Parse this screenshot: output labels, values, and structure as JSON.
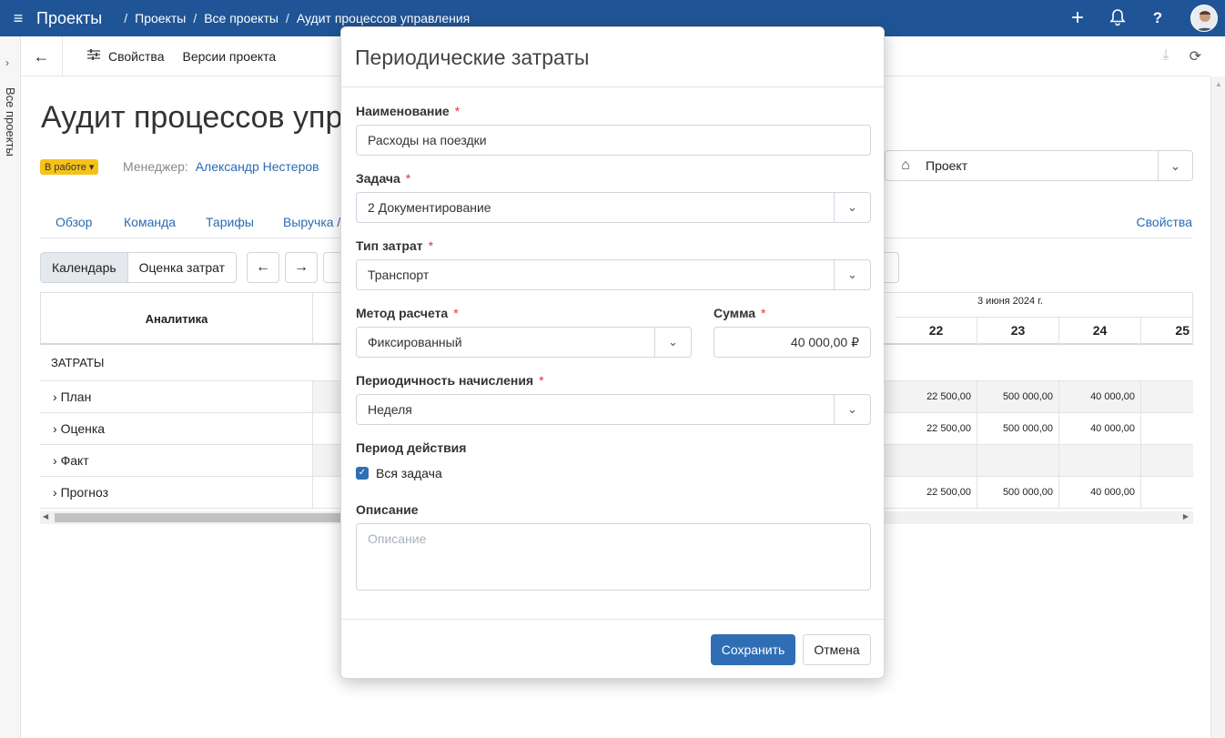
{
  "topbar": {
    "app_title": "Проекты",
    "breadcrumb": [
      "Проекты",
      "Все проекты",
      "Аудит процессов управления"
    ],
    "icons": [
      "plus-icon",
      "bell-icon",
      "help-icon"
    ]
  },
  "rail": {
    "label": "Все проекты"
  },
  "toolbar": {
    "properties": "Свойства",
    "versions": "Версии проекта"
  },
  "project": {
    "title": "Аудит процессов упра",
    "status": "В работе",
    "manager_label": "Менеджер:",
    "manager_name": "Александр Нестеров",
    "selector": "Проект"
  },
  "tabs": [
    "Обзор",
    "Команда",
    "Тарифы",
    "Выручка /"
  ],
  "tabs_right": "Свойства",
  "view": {
    "calendar": "Календарь",
    "estimate": "Оценка затрат"
  },
  "table": {
    "header": "Аналитика",
    "month": "3 июня 2024 г.",
    "days": [
      "22",
      "23",
      "24",
      "25"
    ],
    "section": "ЗАТРАТЫ",
    "rows": [
      {
        "label": "План",
        "values": [
          "22 500,00",
          "500 000,00",
          "40 000,00"
        ]
      },
      {
        "label": "Оценка",
        "values": [
          "22 500,00",
          "500 000,00",
          "40 000,00"
        ]
      },
      {
        "label": "Факт",
        "values": [
          "",
          "",
          ""
        ]
      },
      {
        "label": "Прогноз",
        "values": [
          "22 500,00",
          "500 000,00",
          "40 000,00"
        ]
      }
    ]
  },
  "modal": {
    "title": "Периодические затраты",
    "name_label": "Наименование",
    "name_value": "Расходы на поездки",
    "task_label": "Задача",
    "task_value": "2 Документирование",
    "cost_type_label": "Тип затрат",
    "cost_type_value": "Транспорт",
    "method_label": "Метод расчета",
    "method_value": "Фиксированный",
    "sum_label": "Сумма",
    "sum_value": "40 000,00 ₽",
    "period_label": "Периодичность начисления",
    "period_value": "Неделя",
    "validity_label": "Период действия",
    "whole_task": "Вся задача",
    "desc_label": "Описание",
    "desc_placeholder": "Описание",
    "save": "Сохранить",
    "cancel": "Отмена"
  }
}
